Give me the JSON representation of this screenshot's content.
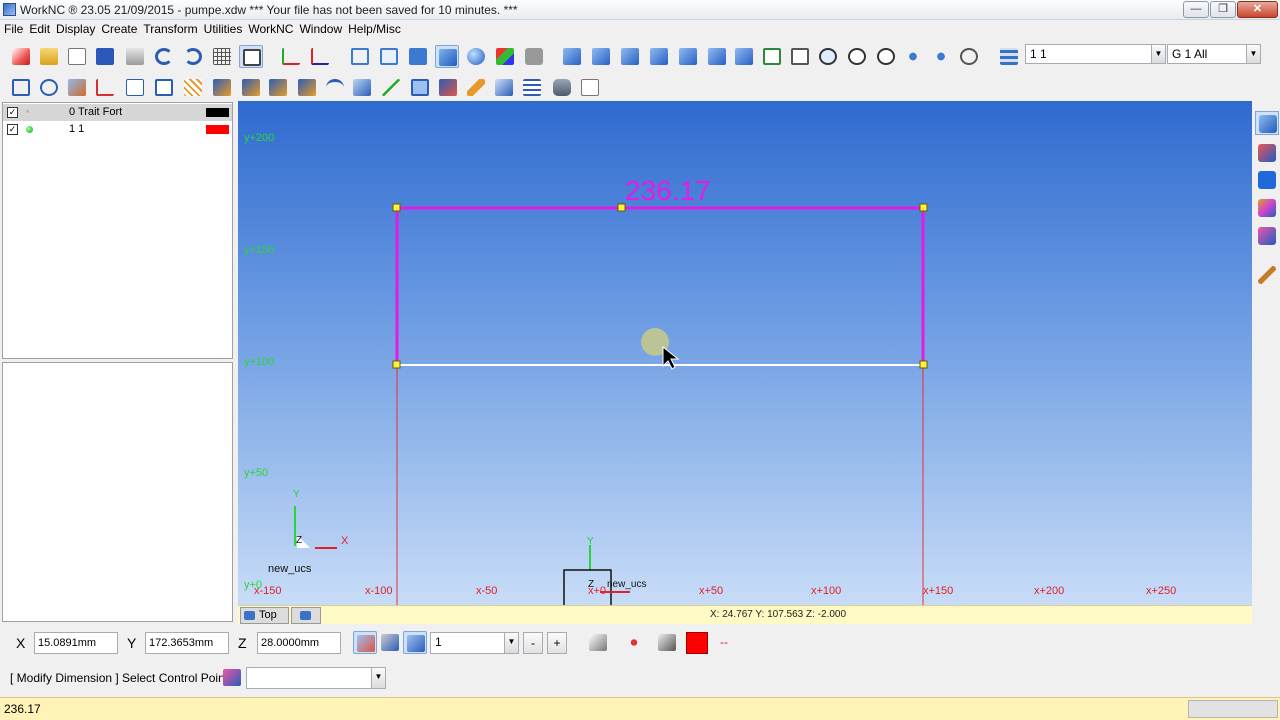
{
  "window": {
    "title": "WorkNC ® 23.05   21/09/2015 - pumpe.xdw *** Your file has not been saved for 10 minutes. ***",
    "min_glyph": "—",
    "max_glyph": "❐",
    "close_glyph": "✕"
  },
  "menu": [
    "File",
    "Edit",
    "Display",
    "Create",
    "Transform",
    "Utilities",
    "WorkNC",
    "Window",
    "Help/Misc"
  ],
  "toolbar": {
    "layer_combo_value": "1  1",
    "group_combo_value": "G   1 All"
  },
  "layers": [
    {
      "visible_mark": "✓",
      "dot": "◦",
      "name": "0 Trait Fort",
      "color": "#000000"
    },
    {
      "visible_mark": "✓",
      "dot": "",
      "name": "1 1",
      "color": "#ff0000"
    }
  ],
  "viewport": {
    "dimension_value": "236.17",
    "y_axis_labels": [
      "y+200",
      "y+150",
      "y+100",
      "y+50",
      "y+0"
    ],
    "x_axis_labels": [
      "x-150",
      "x-100",
      "x-50",
      "x+0",
      "x+50",
      "x+100",
      "x+150",
      "x+200",
      "x+250"
    ],
    "ucs_name": "new_ucs",
    "ucs_name_center": "new_ucs",
    "axis_y": "Y",
    "axis_x": "X",
    "axis_z": "Z",
    "view_tab_label": "Top",
    "cursor_readout": "X: 24.767   Y: 107.563   Z: -2.000",
    "colors": {
      "dimension": "#e21ce4",
      "y_labels": "#26d63a",
      "x_labels": "#e0202a",
      "baseline": "#ffffff"
    }
  },
  "coords": {
    "x_label": "X",
    "x_value": "15.0891mm",
    "y_label": "Y",
    "y_value": "172.3653mm",
    "z_label": "Z",
    "z_value": "28.0000mm",
    "step_value": "1",
    "minus": "-",
    "plus": "+",
    "tail_mark": "--"
  },
  "command": {
    "prompt": "[ Modify Dimension ] Select Control Point"
  },
  "status": {
    "value": "236.17"
  }
}
